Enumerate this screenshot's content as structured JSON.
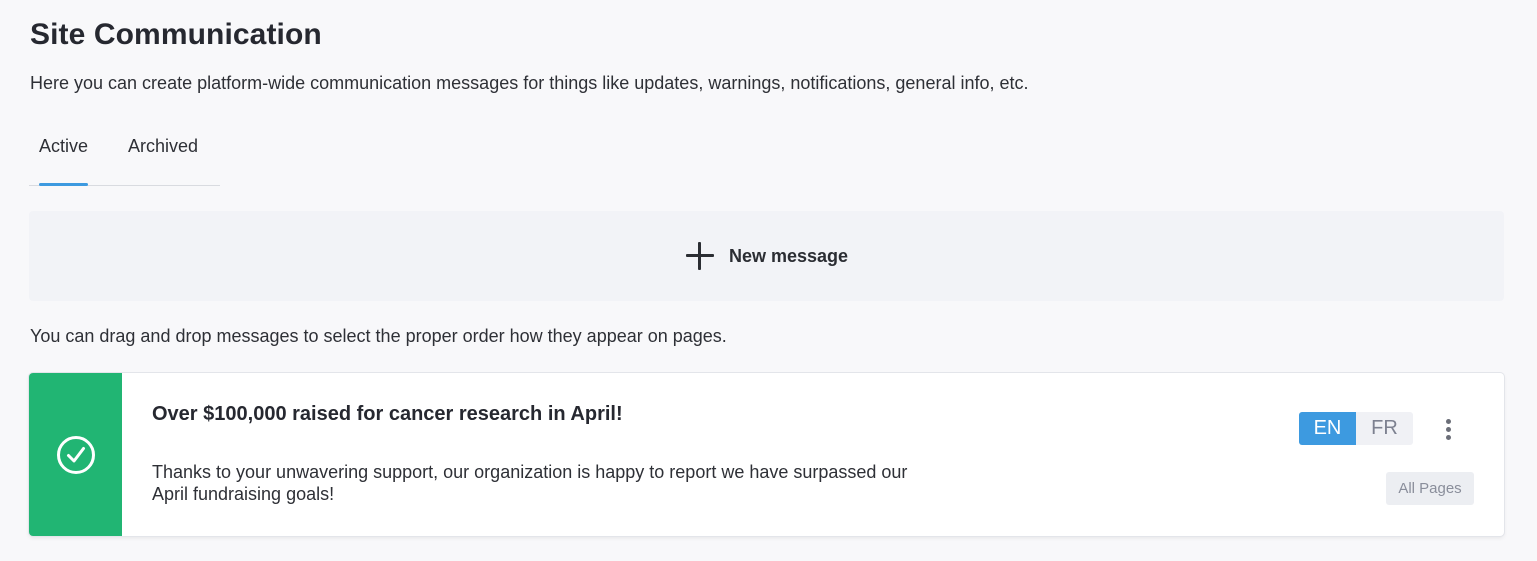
{
  "page": {
    "title": "Site Communication",
    "description": "Here you can create platform-wide communication messages for things like updates, warnings, notifications, general info, etc."
  },
  "tabs": [
    {
      "label": "Active",
      "active": true
    },
    {
      "label": "Archived",
      "active": false
    }
  ],
  "new_message": {
    "icon": "plus-icon",
    "label": "New message"
  },
  "drag_hint": "You can drag and drop messages to select the proper order how they appear on pages.",
  "messages": [
    {
      "status": "success",
      "status_icon": "check-circle-icon",
      "status_color": "#21b573",
      "title": "Over $100,000 raised for cancer research in April!",
      "body": "Thanks to your unwavering support, our organization is happy to report we have surpassed our April fundraising goals!",
      "languages": [
        {
          "code": "EN",
          "selected": true
        },
        {
          "code": "FR",
          "selected": false
        }
      ],
      "menu_icon": "more-vertical-icon",
      "pages_label": "All Pages"
    }
  ],
  "colors": {
    "accent": "#3d9ae0",
    "success": "#21b573",
    "background": "#f8f8fa"
  }
}
